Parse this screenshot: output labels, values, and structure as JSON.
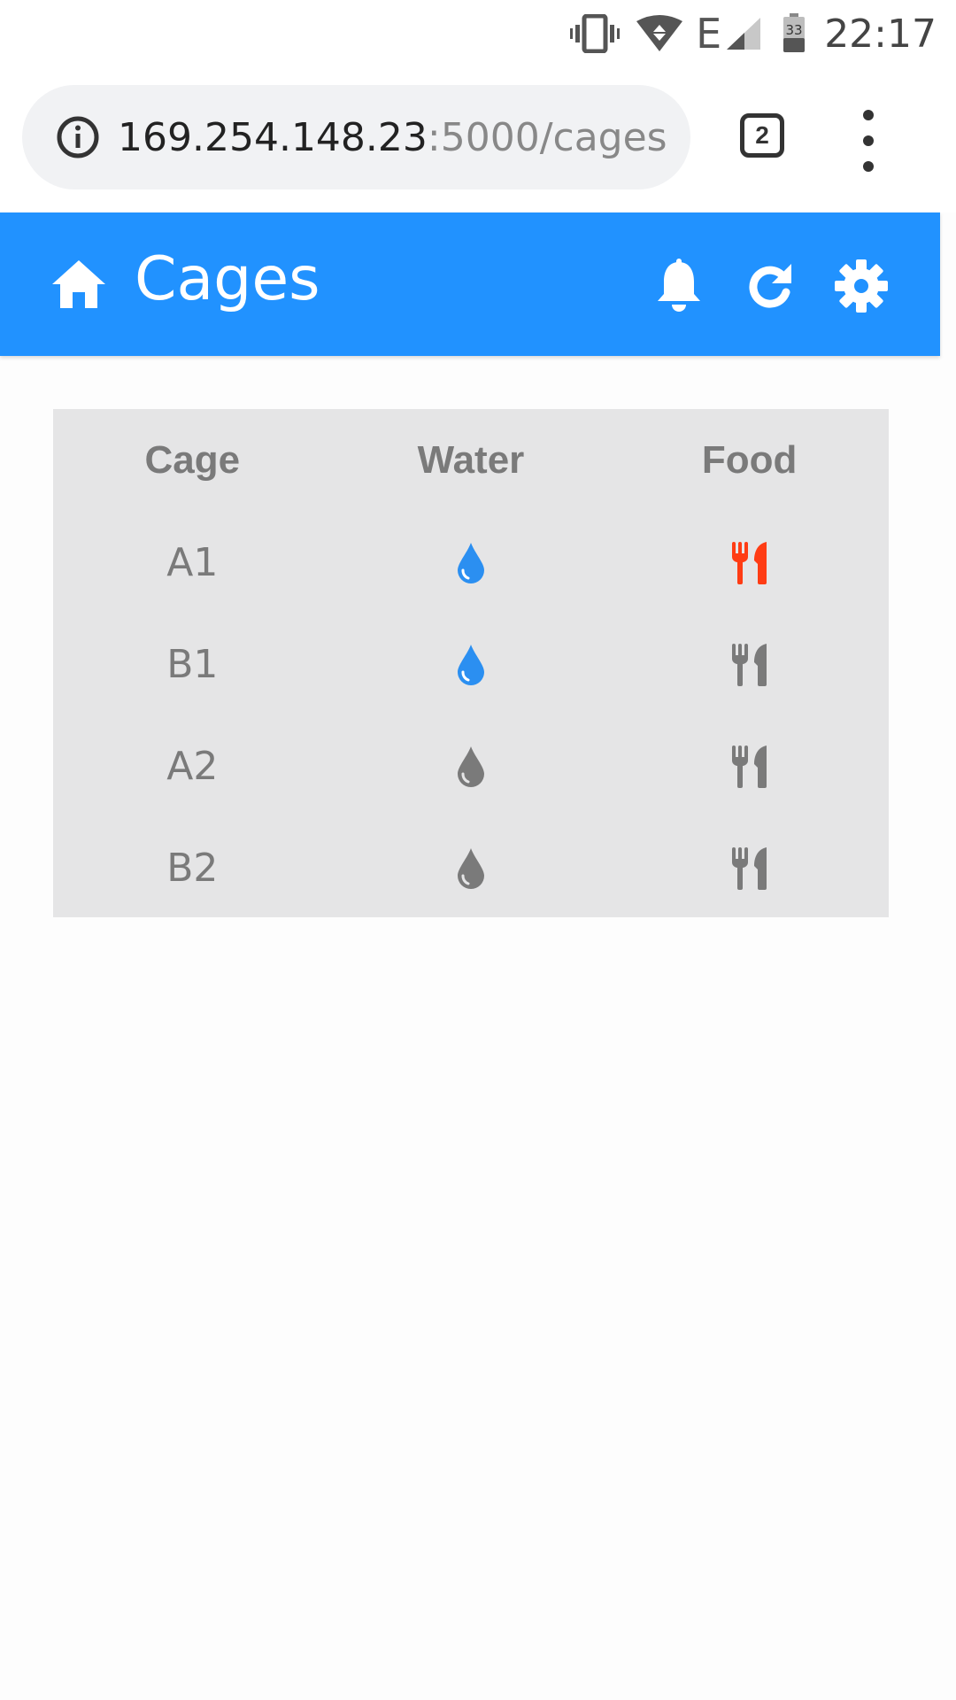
{
  "status_bar": {
    "network_type": "E",
    "battery_level": "33",
    "time": "22:17"
  },
  "browser": {
    "url_host": "169.254.148.23",
    "url_path": ":5000/cages",
    "tab_count": "2"
  },
  "header": {
    "title": "Cages",
    "icons": [
      "home-icon",
      "bell-icon",
      "refresh-icon",
      "gear-icon"
    ],
    "background_color": "#2192ff"
  },
  "table": {
    "columns": [
      "Cage",
      "Water",
      "Food"
    ],
    "rows": [
      {
        "cage": "A1",
        "water_status": "active",
        "food_status": "alert"
      },
      {
        "cage": "B1",
        "water_status": "active",
        "food_status": "normal"
      },
      {
        "cage": "A2",
        "water_status": "inactive",
        "food_status": "normal"
      },
      {
        "cage": "B2",
        "water_status": "inactive",
        "food_status": "normal"
      }
    ],
    "status_colors": {
      "water_active": "#2b8ff1",
      "inactive": "#7a7a7a",
      "food_alert": "#ff3c14"
    }
  }
}
